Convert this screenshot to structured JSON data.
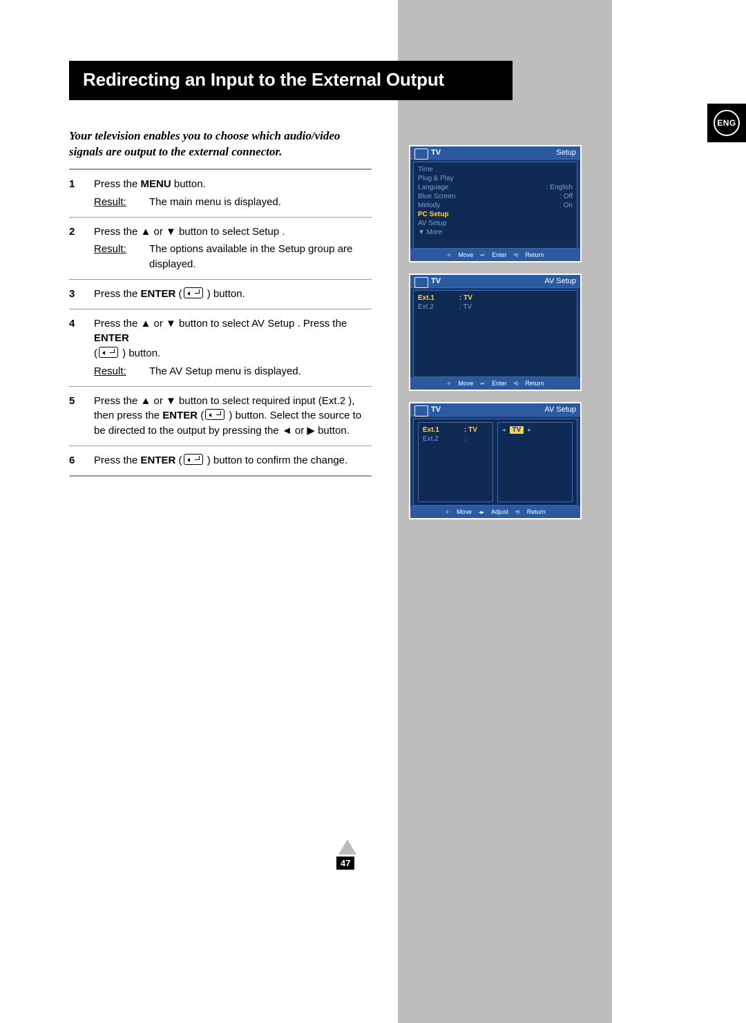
{
  "lang_badge": "ENG",
  "title": "Redirecting an Input to the External Output",
  "intro": "Your television enables you to choose which audio/video signals are output to the external connector.",
  "steps": [
    {
      "num": "1",
      "line_prefix": "Press the ",
      "bold1": "MENU",
      "line_suffix": " button.",
      "result": "The main menu is displayed."
    },
    {
      "num": "2",
      "line": "Press the ▲ or ▼ button to select Setup .",
      "result": "The options available in the Setup  group are displayed."
    },
    {
      "num": "3",
      "line_prefix": "Press the ",
      "bold1": "ENTER",
      "after_bold": " (",
      "after_icon": " ) button."
    },
    {
      "num": "4",
      "line_prefix": "Press the ▲ or ▼ button to select AV Setup . Press the ",
      "bold1": "ENTER",
      "linebreak_prefix": "(",
      "after_icon": " ) button.",
      "result": "The AV Setup  menu is displayed."
    },
    {
      "num": "5",
      "line_prefix": "Press the ▲ or ▼ button to select required input (Ext.2  ), then press the ",
      "bold1": "ENTER",
      "after_bold": " (",
      "after_icon": " ) button. Select the source to be directed to the output by  pressing the ◄ or ▶ button."
    },
    {
      "num": "6",
      "line_prefix": "Press the ",
      "bold1": "ENTER",
      "after_bold": " (",
      "after_icon": " ) button to confirm the change."
    }
  ],
  "result_label": "Result:",
  "osd": {
    "common_footer": {
      "move": "Move",
      "enter": "Enter",
      "return": "Return"
    },
    "screen1": {
      "title": "TV",
      "title_right": "Setup",
      "rows": [
        {
          "l": "Time",
          "r": ""
        },
        {
          "l": "Plug & Play",
          "r": ""
        },
        {
          "l": "Language",
          "r": ": English"
        },
        {
          "l": "Blue Screen",
          "r": ": Off"
        },
        {
          "l": "Melody",
          "r": ": On"
        },
        {
          "l": "PC Setup",
          "r": "",
          "hl": true
        },
        {
          "l": "AV Setup",
          "r": ""
        },
        {
          "l": "▼ More",
          "r": ""
        }
      ]
    },
    "screen2": {
      "title": "TV",
      "title_right": "AV Setup",
      "rows": [
        {
          "l": "Ext.1",
          "r": ": TV",
          "hl": true
        },
        {
          "l": "Ext.2",
          "r": ": TV"
        }
      ]
    },
    "screen3": {
      "title": "TV",
      "title_right": "AV Setup",
      "rows": [
        {
          "l": "Ext.1",
          "r": ": TV",
          "sel": "TV",
          "hl": true
        },
        {
          "l": "Ext.2",
          "r": ":"
        }
      ],
      "footer_adjust": "Adjust"
    }
  },
  "page_number": "47"
}
